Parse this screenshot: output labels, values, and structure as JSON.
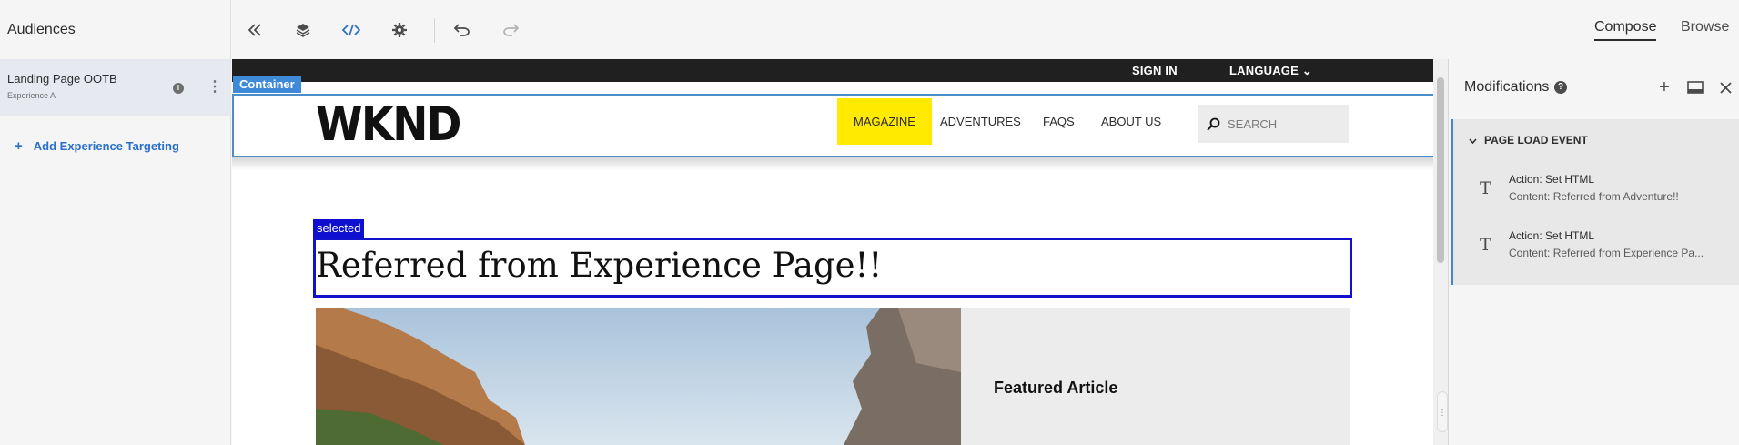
{
  "left_panel": {
    "title": "Audiences",
    "audience": {
      "name": "Landing Page OOTB",
      "sub": "Experience A"
    },
    "add_targeting": "Add Experience Targeting"
  },
  "toolbar": {
    "icons": [
      "collapse-icon",
      "layers-icon",
      "code-icon",
      "settings-icon",
      "undo-icon",
      "redo-icon"
    ],
    "modes": [
      "Compose",
      "Browse"
    ]
  },
  "page": {
    "topbar": {
      "sign_in": "SIGN IN",
      "language": "LANGUAGE"
    },
    "container_tag": "Container",
    "logo": "WKND",
    "nav": [
      "MAGAZINE",
      "ADVENTURES",
      "FAQS",
      "ABOUT US"
    ],
    "search_placeholder": "SEARCH",
    "selected_tag": "selected",
    "headline": "Referred from Experience Page!!",
    "featured": "Featured Article"
  },
  "modifications": {
    "title": "Modifications",
    "event": "PAGE LOAD EVENT",
    "actions": [
      {
        "title": "Action: Set HTML",
        "content": "Content: Referred from Adventure!!"
      },
      {
        "title": "Action: Set HTML",
        "content": "Content: Referred from Experience Pa..."
      }
    ]
  },
  "colors": {
    "accent": "#2a6fca",
    "nav_highlight": "#ffea00",
    "selection": "#1212cc",
    "container": "#3e8ad8"
  }
}
